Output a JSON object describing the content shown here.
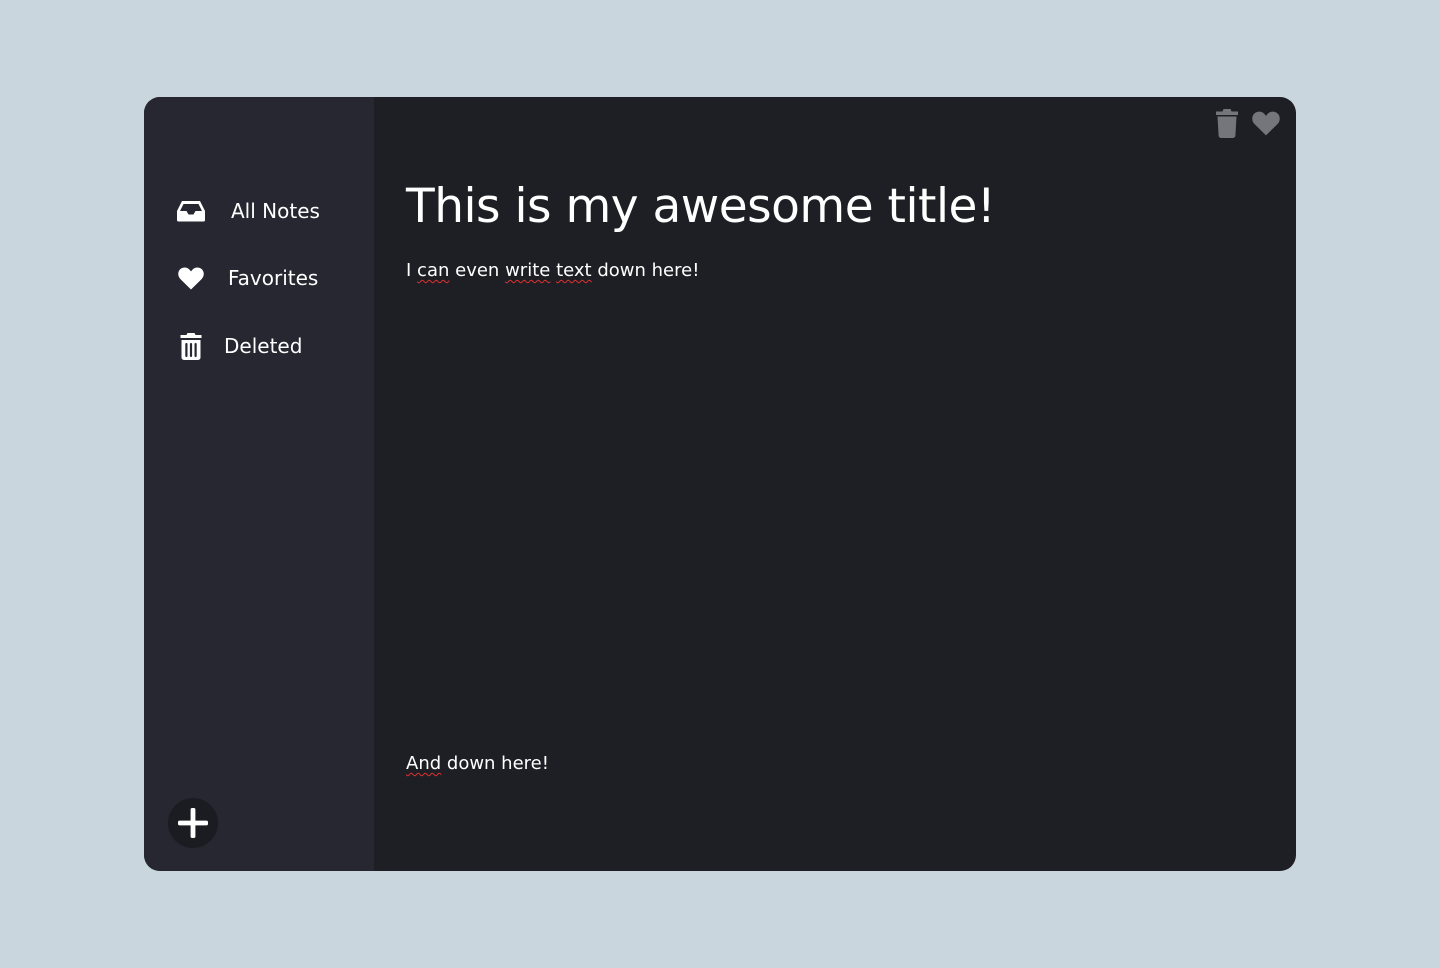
{
  "sidebar": {
    "items": [
      {
        "label": "All Notes",
        "icon": "inbox-icon"
      },
      {
        "label": "Favorites",
        "icon": "heart-icon"
      },
      {
        "label": "Deleted",
        "icon": "trash-icon"
      }
    ],
    "add_button_icon": "plus-icon"
  },
  "toolbar": {
    "icons": [
      "trash-icon",
      "heart-icon"
    ]
  },
  "note": {
    "title": "This is my awesome title!",
    "body_line1": {
      "w1": "I",
      "w2": "can",
      "w3": "even",
      "w4": "write",
      "w5": "text",
      "w6": "down here!"
    },
    "body_line2": {
      "w1": "And",
      "w2": "down here!"
    }
  },
  "colors": {
    "page_background": "#c9d6dd",
    "sidebar_background": "#262731",
    "editor_background": "#1e1f24",
    "text": "#ffffff",
    "toolbar_icon": "#75767b",
    "spellcheck_underline": "#e03030"
  }
}
